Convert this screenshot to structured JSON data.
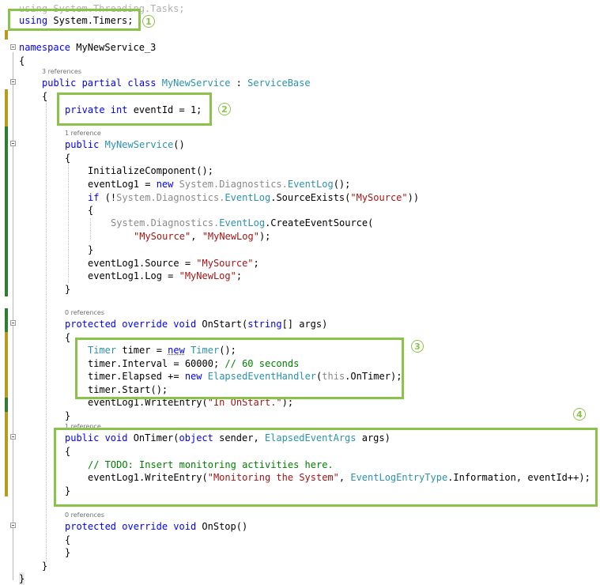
{
  "colors": {
    "keyword": "#0000ff",
    "type": "#2b91af",
    "string": "#a31515",
    "comment": "#008000",
    "highlight_box": "#8bc34a",
    "change_bar_saved": "#2e7d32",
    "change_bar_unsaved": "#b89a1e"
  },
  "code": {
    "using_tasks": "using System.Threading.Tasks;",
    "using_kw": "using",
    "using_ns": " System.Timers;",
    "ns_kw": "namespace",
    "ns_name": " MyNewService_3",
    "brace_open": "{",
    "brace_close": "}",
    "ref_3": "3 references",
    "class_decl": {
      "kw": "public partial class",
      "name": "MyNewService",
      "sep": " : ",
      "base": "ServiceBase"
    },
    "field": {
      "kw": "private int",
      "rest": " eventId = 1;"
    },
    "ref_1": "1 reference",
    "ctor": {
      "kw": "public",
      "name": "MyNewService",
      "rest": "()"
    },
    "init": "InitializeComponent();",
    "evtlog_new": {
      "a": "eventLog1 = ",
      "kw": "new",
      "ns": " System.Diagnostics.",
      "type": "EventLog",
      "end": "();"
    },
    "if_line": {
      "kw": "if",
      "a": " (!",
      "ns": "System.Diagnostics.",
      "type": "EventLog",
      "b": ".SourceExists(",
      "str": "\"MySource\"",
      "end": "))"
    },
    "create_src": {
      "ns": "System.Diagnostics.",
      "type": "EventLog",
      "rest": ".CreateEventSource("
    },
    "create_args": {
      "s1": "\"MySource\"",
      "sep": ", ",
      "s2": "\"MyNewLog\"",
      "end": ");"
    },
    "src_assign": {
      "a": "eventLog1.Source = ",
      "str": "\"MySource\"",
      "end": ";"
    },
    "log_assign": {
      "a": "eventLog1.Log = ",
      "str": "\"MyNewLog\"",
      "end": ";"
    },
    "ref_0": "0 references",
    "onstart": {
      "kw": "protected override void",
      "name": " OnStart(",
      "kw2": "string",
      "rest": "[] args)"
    },
    "timer_new": {
      "type": "Timer",
      "a": " timer = ",
      "kw": "new",
      "b": " ",
      "type2": "Timer",
      "end": "();"
    },
    "timer_interval": {
      "a": "timer.Interval = 60000; ",
      "cm": "// 60 seconds"
    },
    "timer_elapsed": {
      "a": "timer.Elapsed += ",
      "kw": "new",
      "b": " ",
      "type": "ElapsedEventHandler",
      "c": "(",
      "kw2": "this",
      "end": ".OnTimer);"
    },
    "timer_start": "timer.Start();",
    "write_start": {
      "a": "eventLog1.WriteEntry(",
      "str": "\"In OnStart.\"",
      "end": ");"
    },
    "ontimer": {
      "kw": "public void",
      "name": " OnTimer(",
      "kw2": "object",
      "a": " sender, ",
      "type": "ElapsedEventArgs",
      "end": " args)"
    },
    "todo": "// TODO: Insert monitoring activities here.",
    "write_mon": {
      "a": "eventLog1.WriteEntry(",
      "str": "\"Monitoring the System\"",
      "b": ", ",
      "type": "EventLogEntryType",
      "end": ".Information, eventId++);"
    },
    "onstop": {
      "kw": "protected override void",
      "rest": " OnStop()"
    }
  },
  "callouts": [
    "1",
    "2",
    "3",
    "4"
  ]
}
